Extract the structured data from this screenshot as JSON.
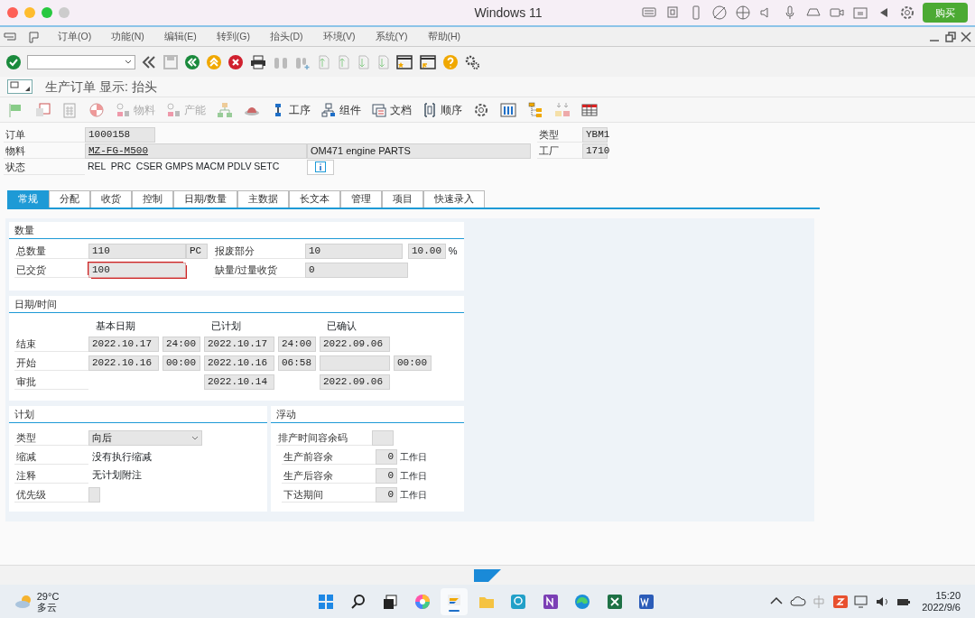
{
  "window": {
    "title": "Windows 11",
    "buy_button": "购买"
  },
  "menu": [
    "订单(O)",
    "功能(N)",
    "编辑(E)",
    "转到(G)",
    "抬头(D)",
    "环境(V)",
    "系统(Y)",
    "帮助(H)"
  ],
  "screen_title": "生产订单 显示: 抬头",
  "app_toolbar": [
    {
      "label": "物料",
      "disabled": true
    },
    {
      "label": "产能",
      "disabled": true
    },
    {
      "label": "工序",
      "disabled": false
    },
    {
      "label": "组件",
      "disabled": false
    },
    {
      "label": "文档",
      "disabled": false
    },
    {
      "label": "顺序",
      "disabled": false
    }
  ],
  "header": {
    "order": {
      "label": "订单",
      "value": "1000158"
    },
    "material": {
      "label": "物料",
      "value": "MZ-FG-M500",
      "description": "OM471 engine PARTS"
    },
    "status": {
      "label": "状态",
      "value": "REL  PRC  CSER GMPS MACM PDLV SETC"
    },
    "type": {
      "label": "类型",
      "value": "YBM1"
    },
    "plant": {
      "label": "工厂",
      "value": "1710"
    }
  },
  "tabs": [
    {
      "label": "常规",
      "selected": true
    },
    {
      "label": "分配",
      "selected": false
    },
    {
      "label": "收货",
      "selected": false
    },
    {
      "label": "控制",
      "selected": false
    },
    {
      "label": "日期/数量",
      "selected": false
    },
    {
      "label": "主数据",
      "selected": false
    },
    {
      "label": "长文本",
      "selected": false
    },
    {
      "label": "管理",
      "selected": false
    },
    {
      "label": "项目",
      "selected": false
    },
    {
      "label": "快速录入",
      "selected": false
    }
  ],
  "quantity": {
    "title": "数量",
    "total": {
      "label": "总数量",
      "value": "110",
      "unit": "PC"
    },
    "scrap": {
      "label": "报废部分",
      "value": "10",
      "percent": "10.00",
      "percent_sign": "%"
    },
    "delivered": {
      "label": "已交货",
      "value": "100",
      "focused": true
    },
    "shortage": {
      "label": "缺量/过量收货",
      "value": "0"
    }
  },
  "dates": {
    "title": "日期/时间",
    "columns": [
      "基本日期",
      "已计划",
      "已确认"
    ],
    "rows": [
      {
        "label": "结束",
        "cells": [
          {
            "date": "2022.10.17",
            "time": "24:00"
          },
          {
            "date": "2022.10.17",
            "time": "24:00"
          },
          {
            "date": "2022.09.06"
          }
        ]
      },
      {
        "label": "开始",
        "cells": [
          {
            "date": "2022.10.16",
            "time": "00:00"
          },
          {
            "date": "2022.10.16",
            "time": "06:58"
          },
          {
            "date_blank": true,
            "time": "00:00"
          }
        ]
      },
      {
        "label": "审批",
        "cells": [
          "",
          {
            "date": "2022.10.14"
          },
          {
            "date": "2022.09.06"
          }
        ]
      }
    ]
  },
  "planning": {
    "title": "计划",
    "rows": [
      {
        "label": "类型",
        "kind": "dropdown",
        "value": "向后"
      },
      {
        "label": "缩减",
        "kind": "text",
        "value": "没有执行缩减"
      },
      {
        "label": "注释",
        "kind": "text",
        "value": "无计划附注"
      },
      {
        "label": "优先级",
        "kind": "blank"
      }
    ]
  },
  "float": {
    "title": "浮动",
    "rows": [
      {
        "label": "排产时间容余码",
        "kind": "blank"
      },
      {
        "label": "生产前容余",
        "kind": "number",
        "value": "0",
        "unit": "工作日"
      },
      {
        "label": "生产后容余",
        "kind": "number",
        "value": "0",
        "unit": "工作日"
      },
      {
        "label": "下达期间",
        "kind": "number",
        "value": "0",
        "unit": "工作日"
      }
    ]
  },
  "taskbar": {
    "weather": {
      "temperature": "29°C",
      "condition": "多云"
    },
    "apps": [
      {
        "kind": "windows",
        "selected": false
      },
      {
        "kind": "search",
        "selected": false
      },
      {
        "kind": "task-view",
        "selected": false
      },
      {
        "kind": "color-wheel",
        "selected": false
      },
      {
        "kind": "sap",
        "selected": true
      },
      {
        "kind": "folder",
        "selected": false
      },
      {
        "kind": "magnifier",
        "selected": false
      },
      {
        "kind": "onenote",
        "selected": false
      },
      {
        "kind": "edge",
        "selected": false
      },
      {
        "kind": "excel",
        "selected": false
      },
      {
        "kind": "word",
        "selected": false
      }
    ],
    "time": "15:20",
    "date": "2022/9/6"
  }
}
